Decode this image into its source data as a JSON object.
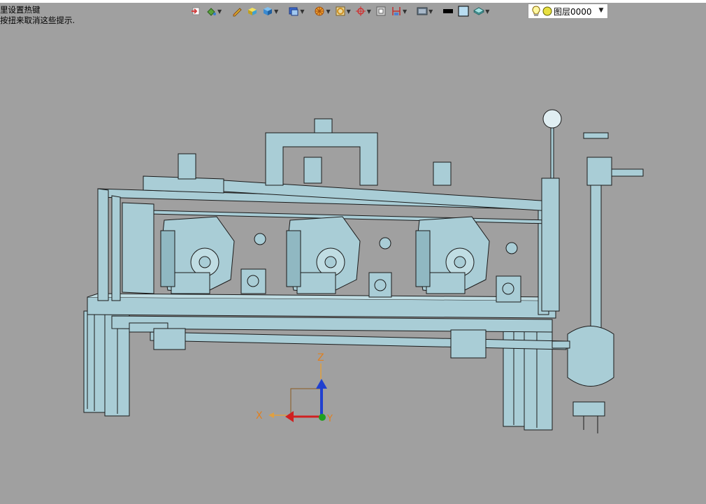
{
  "tip": {
    "line1": "里设置热键",
    "line2": "按扭来取消这些提示."
  },
  "toolbar": {
    "items": [
      {
        "icon": "import-icon",
        "color": "#d04040"
      },
      {
        "icon": "paint-bucket-icon",
        "color": "#5aa03a"
      },
      {
        "icon": "pencil-icon",
        "color": "#d0a020"
      },
      {
        "icon": "cube-yellow-icon",
        "color": "#e0c020"
      },
      {
        "icon": "cube-blue-icon",
        "color": "#3a8ad0"
      },
      {
        "icon": "shaded-view-icon",
        "color": "#3a6ad0"
      },
      {
        "icon": "wheel-icon",
        "color": "#e08020"
      },
      {
        "icon": "rotate-icon",
        "color": "#d09020"
      },
      {
        "icon": "crosshair-icon",
        "color": "#d03030"
      },
      {
        "icon": "section-icon",
        "color": "#606060"
      },
      {
        "icon": "dimension-icon",
        "color": "#c03030"
      },
      {
        "icon": "display-icon",
        "color": "#506070"
      },
      {
        "icon": "color-black-icon",
        "color": "#000000"
      },
      {
        "icon": "color-light-blue-icon",
        "color": "#b8dcf0"
      },
      {
        "icon": "layer-stack-icon",
        "color": "#40a0a0"
      }
    ]
  },
  "layer": {
    "value": "图层0000",
    "bulb_icon": "light-bulb-icon",
    "dot_icon": "layer-color-icon",
    "dot_color": "#e8e040"
  },
  "axes": {
    "x_label": "X",
    "y_label": "Y",
    "z_label": "Z",
    "x_color": "#d02020",
    "y_color": "#20a020",
    "z_color": "#2040d0"
  },
  "model": {
    "fill": "#a9cdd6",
    "stroke": "#1a1a1a"
  }
}
